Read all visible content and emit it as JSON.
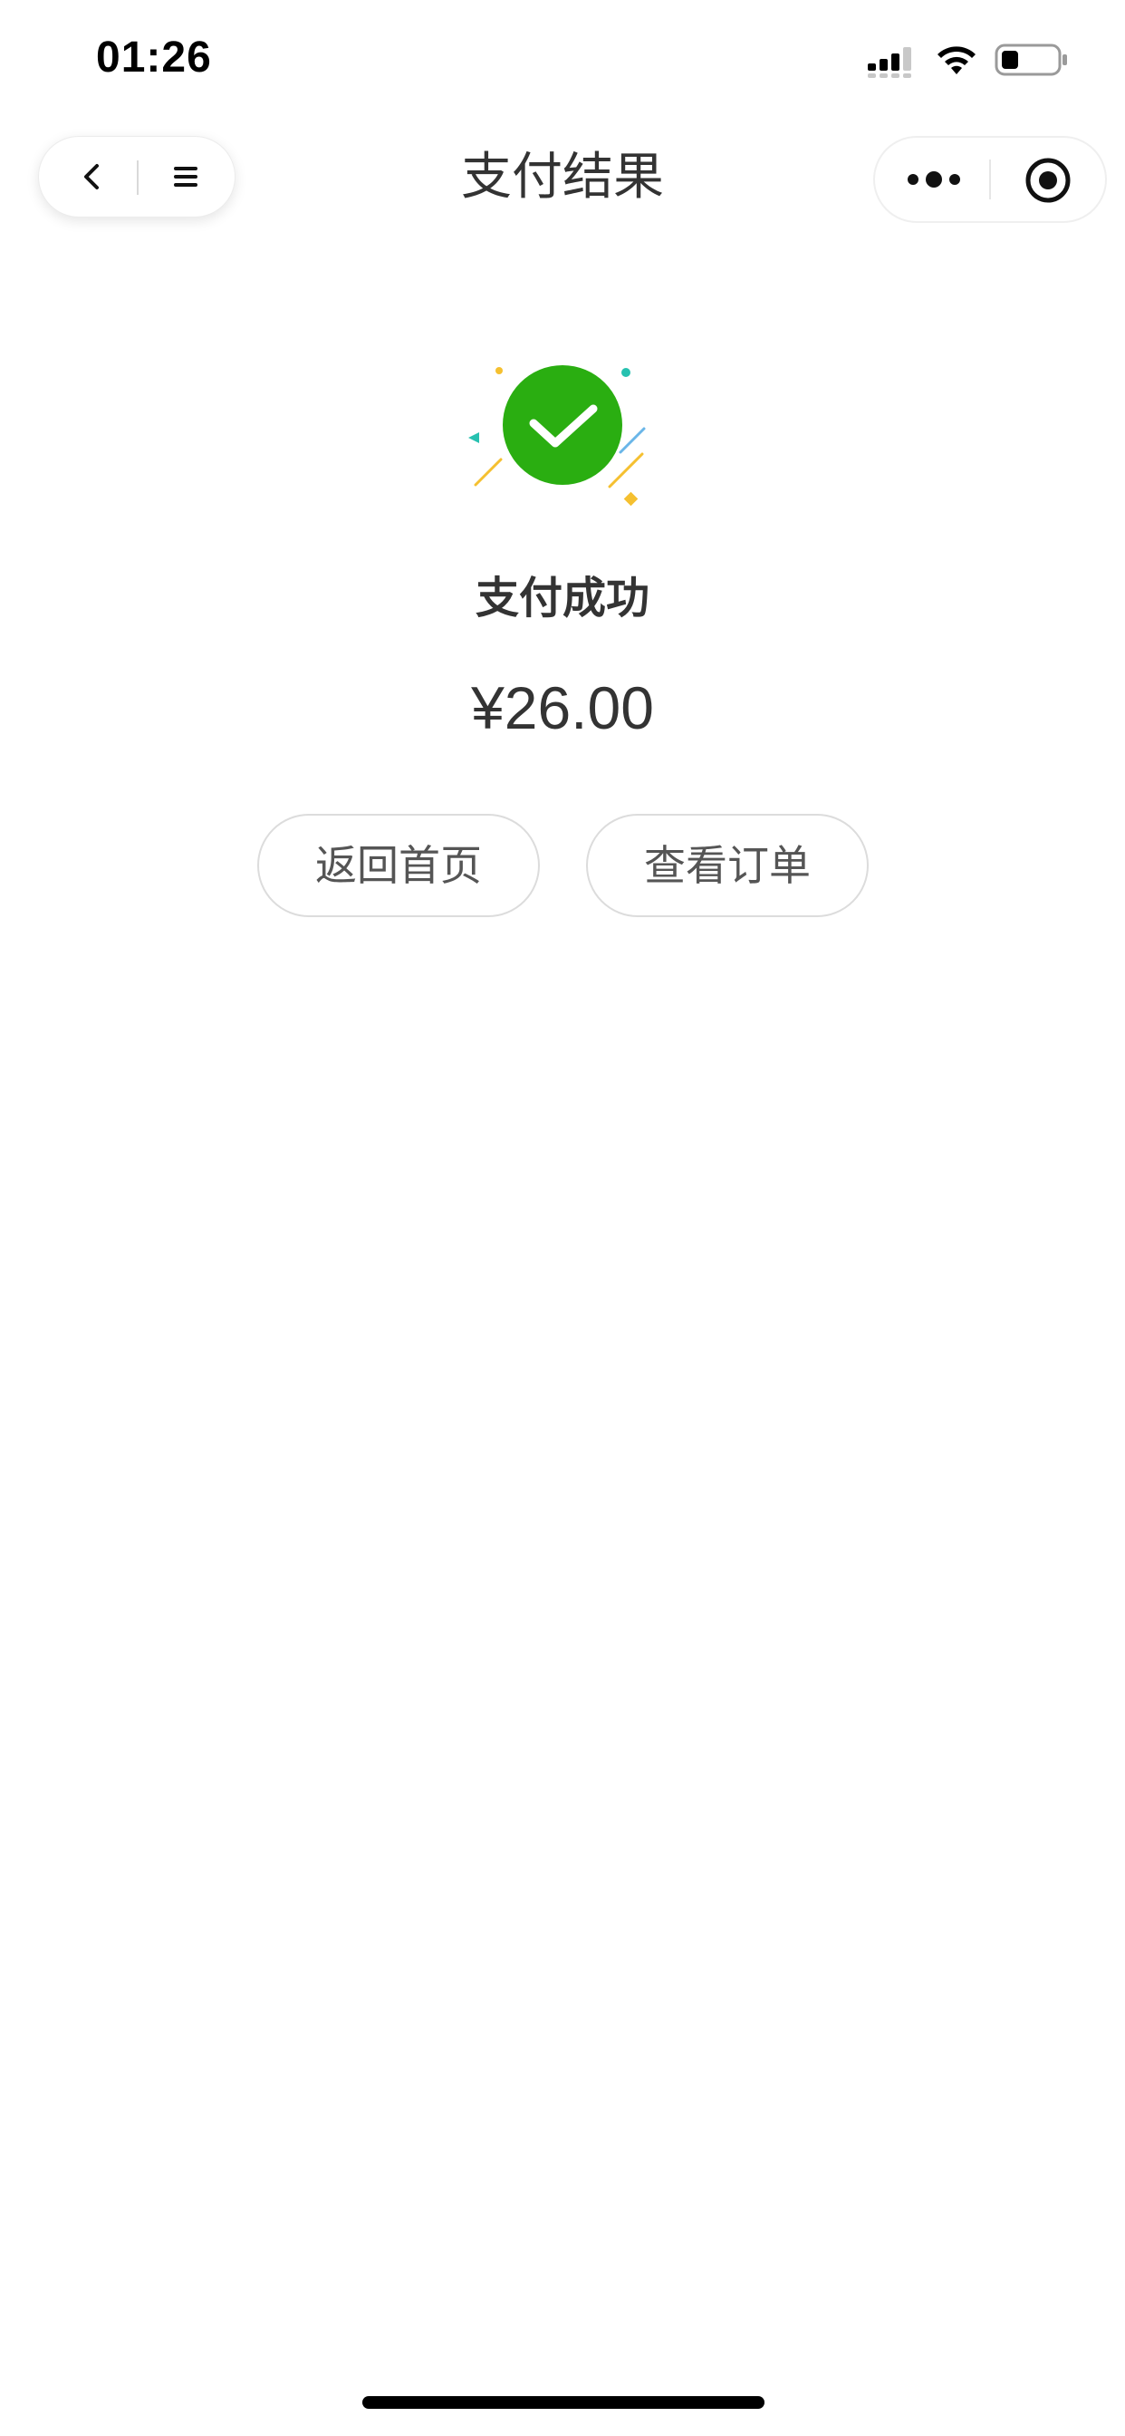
{
  "status_bar": {
    "time": "01:26",
    "icons": [
      "signal-icon",
      "wifi-icon",
      "battery-icon"
    ]
  },
  "nav": {
    "title": "支付结果",
    "left_capsule_icons": [
      "back-icon",
      "menu-icon"
    ],
    "right_capsule_icons": [
      "more-icon",
      "target-icon"
    ]
  },
  "result": {
    "icon": "success-check-icon",
    "title": "支付成功",
    "amount": "¥26.00"
  },
  "actions": {
    "home_label": "返回首页",
    "order_label": "查看订单"
  },
  "colors": {
    "success_green": "#2aae11",
    "text": "#333333",
    "button_border": "#dcdcdc"
  }
}
